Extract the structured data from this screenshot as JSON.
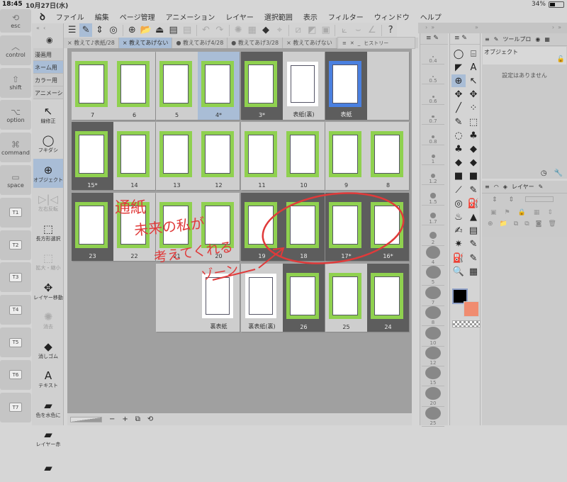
{
  "status": {
    "time": "18:45",
    "date": "10月27日(水)",
    "battery": "34%",
    "battery_level": 0.34
  },
  "keys": [
    {
      "icon": "⟲",
      "label": "esc"
    },
    {
      "icon": "︿",
      "label": "control"
    },
    {
      "icon": "⇧",
      "label": "shift"
    },
    {
      "icon": "⌥",
      "label": "option"
    },
    {
      "icon": "⌘",
      "label": "command"
    },
    {
      "icon": "▭",
      "label": "space"
    },
    {
      "label": "T1"
    },
    {
      "label": "T2"
    },
    {
      "label": "T3"
    },
    {
      "label": "T4"
    },
    {
      "label": "T5"
    },
    {
      "label": "T6"
    },
    {
      "label": "T7"
    }
  ],
  "menu": {
    "logo": "ꝺ",
    "items": [
      "ファイル",
      "編集",
      "ページ管理",
      "アニメーション",
      "レイヤー",
      "選択範囲",
      "表示",
      "フィルター",
      "ウィンドウ",
      "ヘルプ"
    ]
  },
  "left_panel": {
    "set_tabs": [
      "漫画用",
      "ネーム用",
      "カラー用",
      "アニメーシ"
    ],
    "selected_set": 1,
    "tools": [
      {
        "icon": "↖",
        "label": "線修正"
      },
      {
        "icon": "◯",
        "label": "フキダシ"
      },
      {
        "icon": "⊕",
        "label": "オブジェクト",
        "selected": true
      },
      {
        "icon": "▷|◁",
        "label": "左右反転",
        "disabled": true
      },
      {
        "icon": "⬚",
        "label": "長方形選択"
      },
      {
        "icon": "⬚",
        "label": "拡大・縮小",
        "disabled": true
      },
      {
        "icon": "✥",
        "label": "レイヤー移動"
      },
      {
        "icon": "✺",
        "label": "消去",
        "disabled": true
      },
      {
        "icon": "◆",
        "label": "消しゴム"
      },
      {
        "icon": "A",
        "label": "テキスト"
      },
      {
        "icon": "▰",
        "label": "色を水色に"
      },
      {
        "icon": "▰",
        "label": "レイヤー赤"
      },
      {
        "icon": "▰",
        "label": ""
      }
    ]
  },
  "toolbar": [
    {
      "icon": "☰"
    },
    {
      "icon": "✎",
      "selected": true
    },
    {
      "icon": "⇕"
    },
    {
      "icon": "◎"
    },
    {
      "sep": true
    },
    {
      "icon": "⊕"
    },
    {
      "icon": "📂"
    },
    {
      "icon": "⏏"
    },
    {
      "icon": "▤"
    },
    {
      "icon": "▤",
      "disabled": true
    },
    {
      "sep": true
    },
    {
      "icon": "↶",
      "disabled": true
    },
    {
      "icon": "↷",
      "disabled": true
    },
    {
      "sep": true
    },
    {
      "icon": "✺",
      "disabled": true
    },
    {
      "icon": "▦",
      "disabled": true
    },
    {
      "icon": "◆"
    },
    {
      "icon": "⌖",
      "disabled": true
    },
    {
      "sep": true
    },
    {
      "icon": "⧄",
      "disabled": true
    },
    {
      "icon": "◩",
      "disabled": true
    },
    {
      "icon": "▣",
      "disabled": true
    },
    {
      "sep": true
    },
    {
      "icon": "⟀",
      "disabled": true
    },
    {
      "icon": "⌣",
      "disabled": true
    },
    {
      "icon": "∠",
      "disabled": true
    },
    {
      "sep": true
    },
    {
      "icon": "?"
    }
  ],
  "tabs": [
    {
      "label": "× 教えて♪表紙/28"
    },
    {
      "label": "× 教えてあげない",
      "selected": true
    },
    {
      "label": "● 教えてあげ4/28"
    },
    {
      "label": "● 教えてあげ3/28"
    },
    {
      "label": "× 教えてあげない"
    }
  ],
  "history": {
    "label": "ヒストリー"
  },
  "spreads": [
    {
      "row": 0,
      "col": 0,
      "pages": [
        {
          "label": "7",
          "frame": "green"
        },
        {
          "label": "6",
          "frame": "green"
        }
      ]
    },
    {
      "row": 0,
      "col": 1,
      "pages": [
        {
          "label": "5",
          "frame": "green"
        },
        {
          "label": "4*",
          "frame": "green",
          "selected": true
        }
      ]
    },
    {
      "row": 0,
      "col": 2,
      "pages": [
        {
          "label": "3*",
          "frame": "green",
          "dark": true
        },
        {
          "label": "表紙(裏)",
          "frame": "white"
        }
      ]
    },
    {
      "row": 0,
      "col": 3,
      "pages": [
        {
          "label": "表紙",
          "frame": "blue",
          "dark": true
        },
        null
      ]
    },
    {
      "row": 1,
      "col": 0,
      "pages": [
        {
          "label": "15*",
          "frame": "green",
          "dark": true
        },
        {
          "label": "14",
          "frame": "green"
        }
      ]
    },
    {
      "row": 1,
      "col": 1,
      "pages": [
        {
          "label": "13",
          "frame": "green"
        },
        {
          "label": "12",
          "frame": "green"
        }
      ]
    },
    {
      "row": 1,
      "col": 2,
      "pages": [
        {
          "label": "11",
          "frame": "green"
        },
        {
          "label": "10",
          "frame": "green"
        }
      ]
    },
    {
      "row": 1,
      "col": 3,
      "pages": [
        {
          "label": "9",
          "frame": "green"
        },
        {
          "label": "8",
          "frame": "green"
        }
      ]
    },
    {
      "row": 2,
      "col": 0,
      "pages": [
        {
          "label": "23",
          "frame": "green",
          "dark": true
        },
        {
          "label": "22",
          "frame": "green"
        }
      ]
    },
    {
      "row": 2,
      "col": 1,
      "pages": [
        {
          "label": "21",
          "frame": "green"
        },
        {
          "label": "20",
          "frame": "green"
        }
      ]
    },
    {
      "row": 2,
      "col": 2,
      "pages": [
        {
          "label": "19",
          "frame": "green",
          "dark": true
        },
        {
          "label": "18",
          "frame": "green",
          "dark": true
        }
      ]
    },
    {
      "row": 2,
      "col": 3,
      "pages": [
        {
          "label": "17*",
          "frame": "green",
          "dark": true
        },
        {
          "label": "16*",
          "frame": "green",
          "dark": true
        }
      ]
    },
    {
      "row": 3,
      "col": 1,
      "pages": [
        null,
        {
          "label": "裏表紙",
          "frame": "white"
        }
      ]
    },
    {
      "row": 3,
      "col": 2,
      "pages": [
        {
          "label": "裏表紙(裏)",
          "frame": "white"
        },
        {
          "label": "26",
          "frame": "green",
          "dark": true
        }
      ]
    },
    {
      "row": 3,
      "col": 3,
      "pages": [
        {
          "label": "25",
          "frame": "green"
        },
        {
          "label": "24",
          "frame": "green",
          "dark": true
        }
      ]
    }
  ],
  "annotation": {
    "color": "#e03a3a",
    "line1": "通紙",
    "line2": "未来の私が",
    "line3": "考えてくれる",
    "line4": "ゾーン"
  },
  "bottombar": {
    "minus": "−",
    "plus": "+",
    "icon1": "⧉",
    "icon2": "⟲"
  },
  "brush_sizes": [
    "0.4",
    "0.5",
    "0.6",
    "0.7",
    "0.8",
    "1",
    "1.2",
    "1.5",
    "1.7",
    "2",
    "4",
    "5",
    "7",
    "8",
    "10",
    "12",
    "15",
    "20",
    "25"
  ],
  "palette": [
    "◯",
    "⌸",
    "◤",
    "A",
    "⊕",
    "↖",
    "✥",
    "✥",
    "╱",
    "⁘",
    "✎",
    "⬚",
    "◌",
    "♣",
    "♣",
    "◆",
    "◆",
    "◆",
    "■",
    "■",
    "⟋",
    "✎",
    "◎",
    "⛽",
    "♨",
    "▲",
    "✍",
    "▤",
    "✷",
    "✎",
    "⛽",
    "✎",
    "🔍",
    "▦"
  ],
  "colors": {
    "main": "#000000",
    "sub": "#f08c70",
    "accent": "#a9bdd6",
    "page_frame": "#8fd14f"
  },
  "tool_property": {
    "tab": "ツールプロ",
    "object": "オブジェクト",
    "no_settings": "設定はありません"
  },
  "layer_panel": {
    "tab": "レイヤー"
  }
}
